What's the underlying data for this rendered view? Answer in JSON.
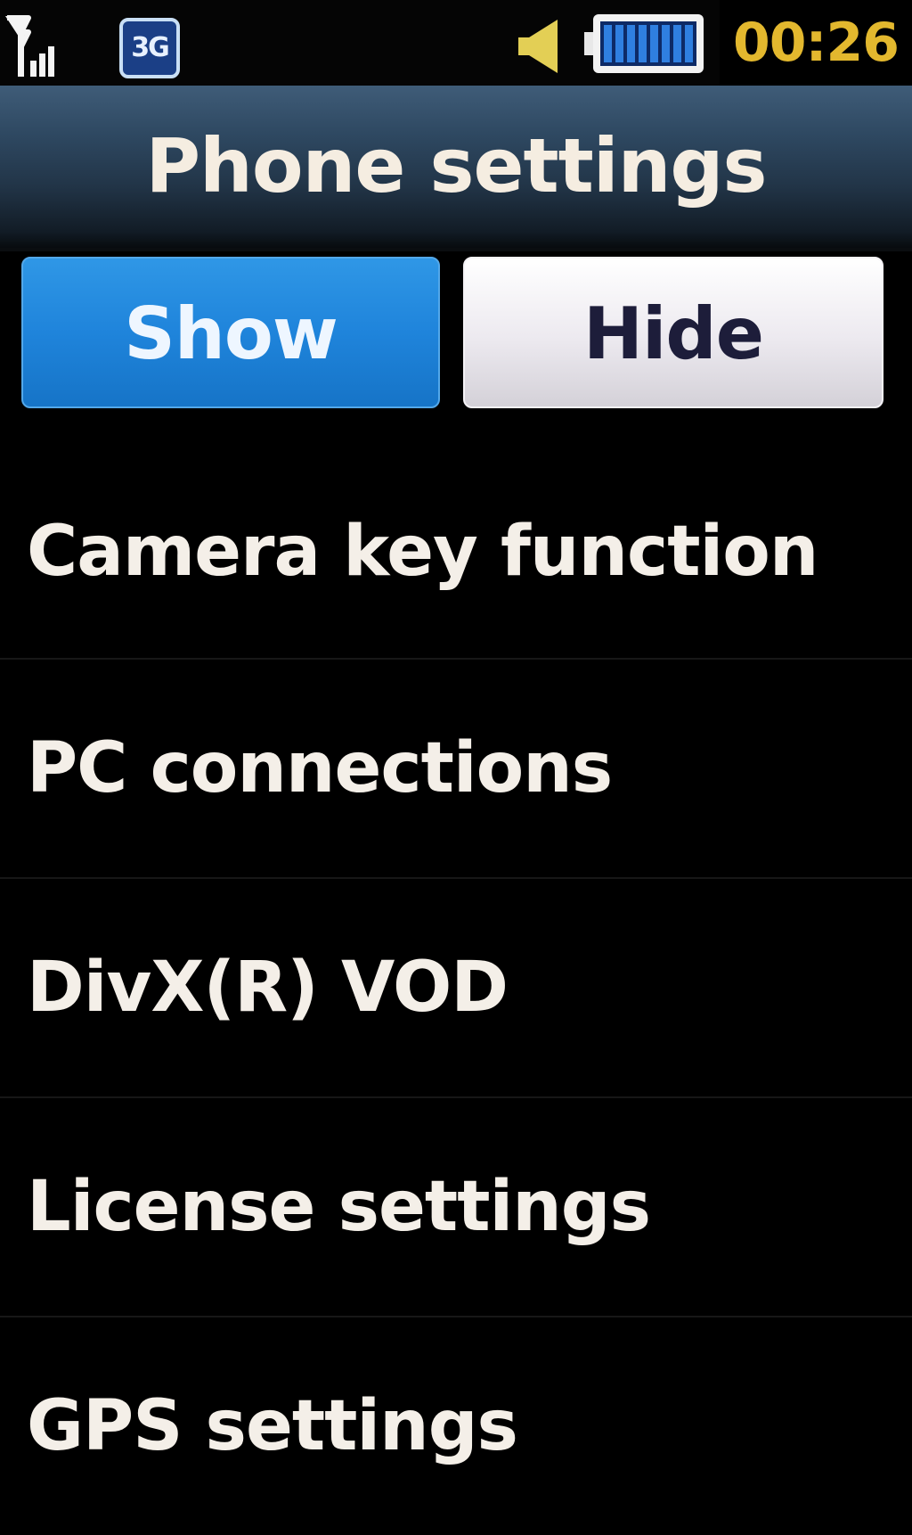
{
  "status_bar": {
    "icons": [
      "signal-strength-icon",
      "3g-network-icon",
      "volume-icon",
      "battery-icon"
    ],
    "network_label": "3G",
    "battery_level": 1.0,
    "time": "00:26",
    "colors": {
      "clock": "#e3b82e",
      "volume": "#e3cf55",
      "battery_fill": "#2f7fe0"
    }
  },
  "header": {
    "title": "Phone settings"
  },
  "toggle": {
    "show_label": "Show",
    "hide_label": "Hide",
    "selected": "Show",
    "colors": {
      "selected": "#1f84db",
      "unselected": "#ece9ef"
    }
  },
  "menu": {
    "items": [
      {
        "label": "Camera key function"
      },
      {
        "label": "PC connections"
      },
      {
        "label": "DivX(R) VOD"
      },
      {
        "label": "License settings"
      },
      {
        "label": "GPS settings"
      }
    ]
  }
}
